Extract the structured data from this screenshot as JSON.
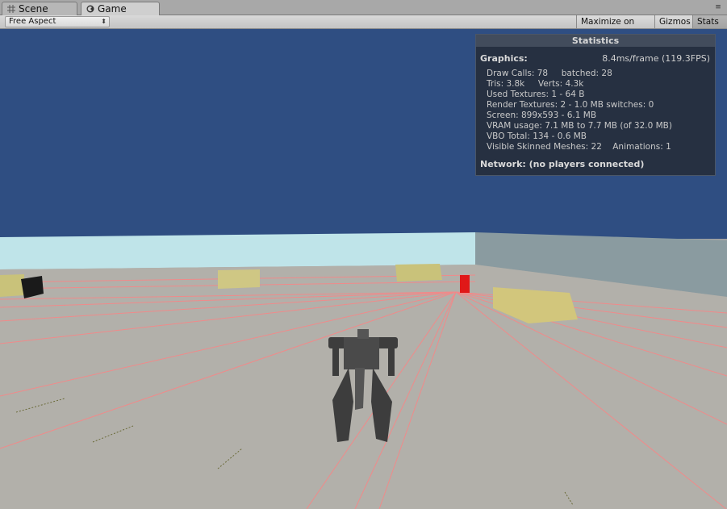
{
  "tabs": [
    {
      "label": "Scene",
      "icon": "grid-icon"
    },
    {
      "label": "Game",
      "icon": "game-icon"
    }
  ],
  "menu_icon": "≡",
  "toolbar": {
    "aspect": "Free Aspect",
    "maximize_label": "Maximize on Play",
    "gizmos_label": "Gizmos",
    "stats_label": "Stats"
  },
  "stats": {
    "title": "Statistics",
    "graphics_label": "Graphics:",
    "fps": "8.4ms/frame (119.3FPS)",
    "lines": [
      "Draw Calls: 78     batched: 28",
      "Tris: 3.8k     Verts: 4.3k",
      "Used Textures: 1 - 64 B",
      "Render Textures: 2 - 1.0 MB switches: 0",
      "Screen: 899x593 - 6.1 MB",
      "VRAM usage: 7.1 MB to 7.7 MB (of 32.0 MB)",
      "VBO Total: 134 - 0.6 MB",
      "Visible Skinned Meshes: 22    Animations: 1"
    ],
    "network_label": "Network: (no players connected)"
  },
  "colors": {
    "sky": "#2f4e82",
    "ground": "#b2b0aa",
    "wall": "#bfe4e9",
    "grid_line": "#f08a8a"
  }
}
